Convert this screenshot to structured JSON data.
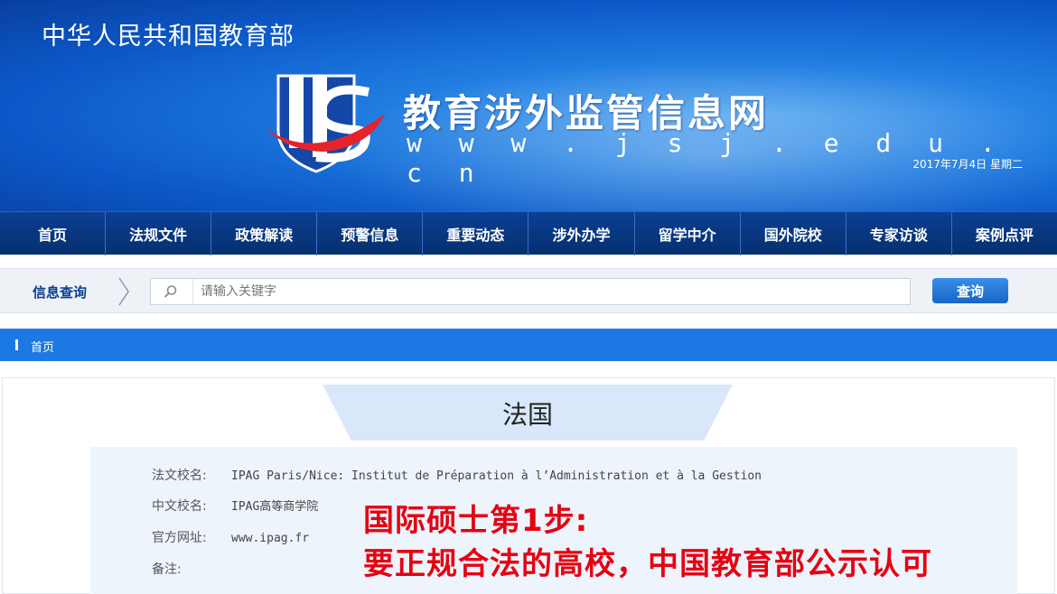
{
  "header": {
    "ministry": "中华人民共和国教育部",
    "site_name": "教育涉外监管信息网",
    "site_url": "w w w . j s j . e d u . c n",
    "date": "2017年7月4日  星期二"
  },
  "nav": {
    "items": [
      {
        "label": "首页"
      },
      {
        "label": "法规文件"
      },
      {
        "label": "政策解读"
      },
      {
        "label": "预警信息"
      },
      {
        "label": "重要动态"
      },
      {
        "label": "涉外办学"
      },
      {
        "label": "留学中介"
      },
      {
        "label": "国外院校"
      },
      {
        "label": "专家访谈"
      },
      {
        "label": "案例点评"
      }
    ]
  },
  "search": {
    "label": "信息查询",
    "placeholder": "请输入关键字",
    "button": "查询"
  },
  "breadcrumb": {
    "home": "首页"
  },
  "country": {
    "title": "法国"
  },
  "school": {
    "fr_label": "法文校名:",
    "fr_value": "IPAG Paris/Nice: Institut de Préparation à l’Administration et à la Gestion",
    "cn_label": "中文校名:",
    "cn_value": "IPAG高等商学院",
    "url_label": "官方网址:",
    "url_value": "www.ipag.fr",
    "note_label": "备注:"
  },
  "overlay": {
    "line1": "国际硕士第1步:",
    "line2": "要正规合法的高校，中国教育部公示认可"
  },
  "colors": {
    "banner": "#0c58c8",
    "nav": "#0b3f93",
    "breadcrumb": "#1c79e3",
    "overlay_text": "#e60012"
  }
}
